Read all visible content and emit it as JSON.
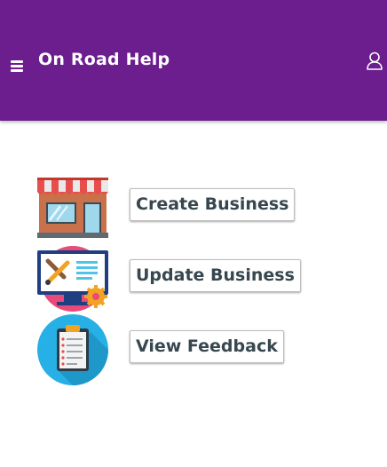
{
  "header": {
    "title": "On Road Help",
    "menu_icon": "hamburger-menu-icon",
    "user_icon": "user-icon",
    "background_color": "#6c1d8e"
  },
  "actions": [
    {
      "label": "Create Business",
      "icon": "storefront-icon"
    },
    {
      "label": "Update Business",
      "icon": "computer-settings-icon"
    },
    {
      "label": "View Feedback",
      "icon": "clipboard-icon"
    }
  ]
}
